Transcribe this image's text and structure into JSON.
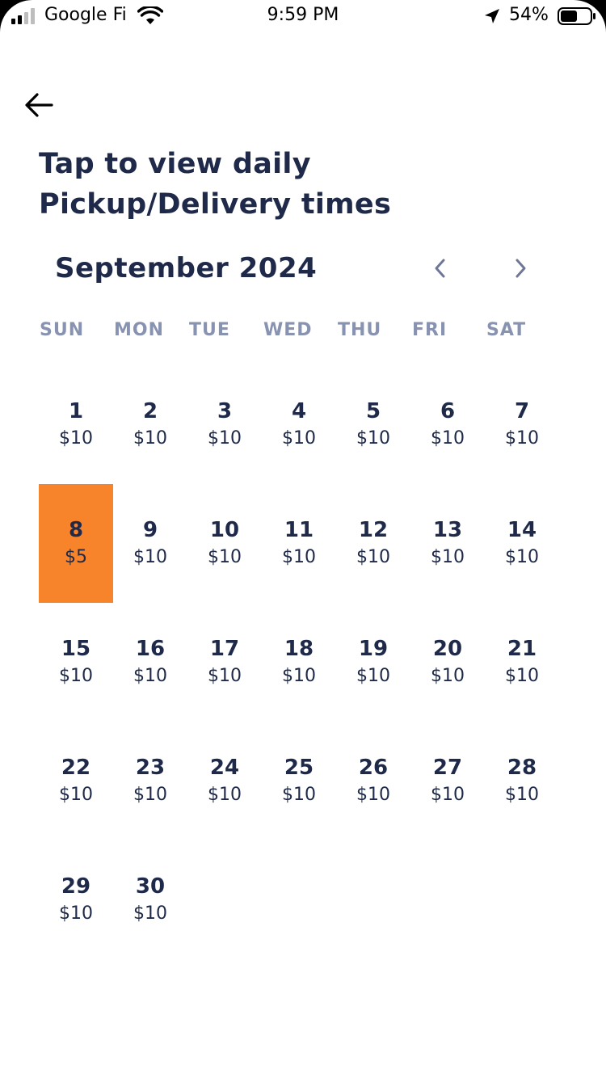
{
  "status_bar": {
    "carrier": "Google Fi",
    "time": "9:59 PM",
    "battery_percent": "54%",
    "icons": [
      "signal-icon",
      "wifi-icon",
      "location-arrow-icon",
      "battery-icon"
    ]
  },
  "header": {
    "back_icon": "arrow-left-icon",
    "title": "Tap to view daily Pickup/Delivery times"
  },
  "calendar": {
    "month_label": "September 2024",
    "prev_icon": "chevron-left-icon",
    "next_icon": "chevron-right-icon",
    "weekdays": [
      "SUN",
      "MON",
      "TUE",
      "WED",
      "THU",
      "FRI",
      "SAT"
    ],
    "selected_day": "8",
    "days": [
      {
        "day": "1",
        "price": "$10"
      },
      {
        "day": "2",
        "price": "$10"
      },
      {
        "day": "3",
        "price": "$10"
      },
      {
        "day": "4",
        "price": "$10"
      },
      {
        "day": "5",
        "price": "$10"
      },
      {
        "day": "6",
        "price": "$10"
      },
      {
        "day": "7",
        "price": "$10"
      },
      {
        "day": "8",
        "price": "$5"
      },
      {
        "day": "9",
        "price": "$10"
      },
      {
        "day": "10",
        "price": "$10"
      },
      {
        "day": "11",
        "price": "$10"
      },
      {
        "day": "12",
        "price": "$10"
      },
      {
        "day": "13",
        "price": "$10"
      },
      {
        "day": "14",
        "price": "$10"
      },
      {
        "day": "15",
        "price": "$10"
      },
      {
        "day": "16",
        "price": "$10"
      },
      {
        "day": "17",
        "price": "$10"
      },
      {
        "day": "18",
        "price": "$10"
      },
      {
        "day": "19",
        "price": "$10"
      },
      {
        "day": "20",
        "price": "$10"
      },
      {
        "day": "21",
        "price": "$10"
      },
      {
        "day": "22",
        "price": "$10"
      },
      {
        "day": "23",
        "price": "$10"
      },
      {
        "day": "24",
        "price": "$10"
      },
      {
        "day": "25",
        "price": "$10"
      },
      {
        "day": "26",
        "price": "$10"
      },
      {
        "day": "27",
        "price": "$10"
      },
      {
        "day": "28",
        "price": "$10"
      },
      {
        "day": "29",
        "price": "$10"
      },
      {
        "day": "30",
        "price": "$10"
      }
    ]
  },
  "colors": {
    "accent": "#f7832a",
    "text": "#1f2a4a",
    "weekday": "#8893b2",
    "nav": "#6e7896"
  }
}
